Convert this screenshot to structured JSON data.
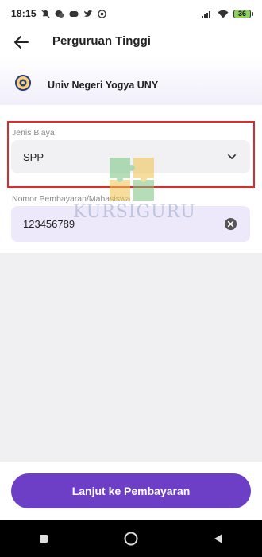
{
  "status_bar": {
    "time": "18:15",
    "battery_level": "36"
  },
  "header": {
    "title": "Perguruan Tinggi",
    "back_icon": "arrow-left-icon"
  },
  "institution": {
    "name": "Univ Negeri Yogya UNY",
    "logo_icon": "university-logo"
  },
  "form": {
    "fee_type": {
      "label": "Jenis Biaya",
      "value": "SPP"
    },
    "payment_number": {
      "label": "Nomor Pembayaran/Mahasiswa",
      "value": "123456789"
    }
  },
  "watermark": {
    "text": "KURSIGURU"
  },
  "footer": {
    "continue_label": "Lanjut ke Pembayaran"
  },
  "colors": {
    "primary": "#6d3fc7",
    "input_bg": "#ede8fa",
    "highlight": "#e02b2b"
  }
}
